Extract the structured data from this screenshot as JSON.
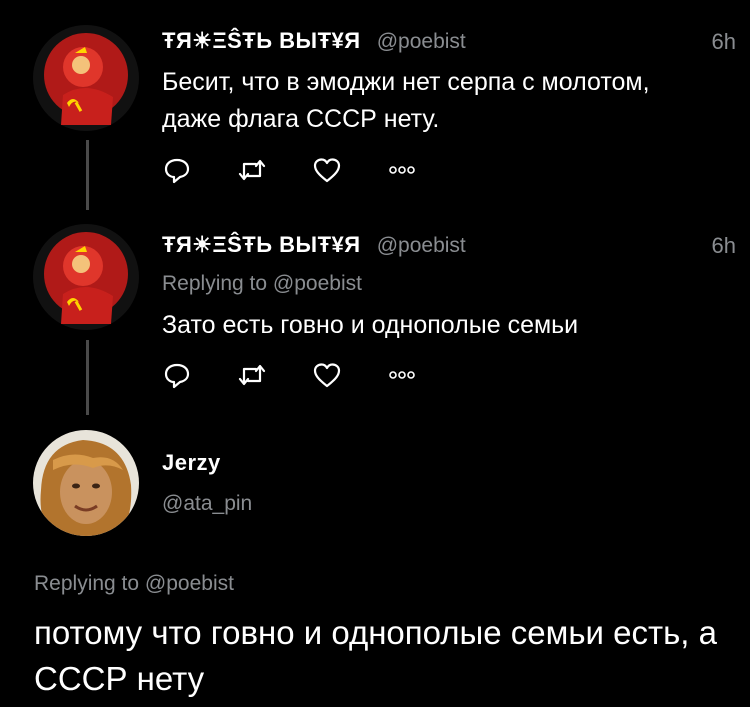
{
  "tweets": [
    {
      "display_name": "ŦЯ☀ΞŜŦЬ ВЫŦ¥Я",
      "handle": "@poebist",
      "time": "6h",
      "text": "Бесит, что в эмоджи нет серпа с молотом, даже флага СССР нету.",
      "avatar_icon": "communist-avatar-icon"
    },
    {
      "display_name": "ŦЯ☀ΞŜŦЬ ВЫŦ¥Я",
      "handle": "@poebist",
      "time": "6h",
      "replying_prefix": "Replying to",
      "replying_handle": "@poebist",
      "text": "Зато есть говно и однополые семьи",
      "avatar_icon": "communist-avatar-icon"
    }
  ],
  "reply": {
    "display_name": "Jerzy",
    "handle": "@ata_pin",
    "replying_prefix": "Replying to",
    "replying_handle": "@poebist",
    "text": "потому что говно и однополые семьи есть, а СССР нету",
    "avatar_icon": "user-photo-avatar-icon"
  },
  "action_icons": [
    "reply-icon",
    "retweet-icon",
    "like-icon",
    "more-icon"
  ],
  "colors": {
    "background": "#000000",
    "text": "#ffffff",
    "secondary": "#8a8d91",
    "thread_line": "#4a4a4a",
    "avatar_red": "#c8201c"
  }
}
